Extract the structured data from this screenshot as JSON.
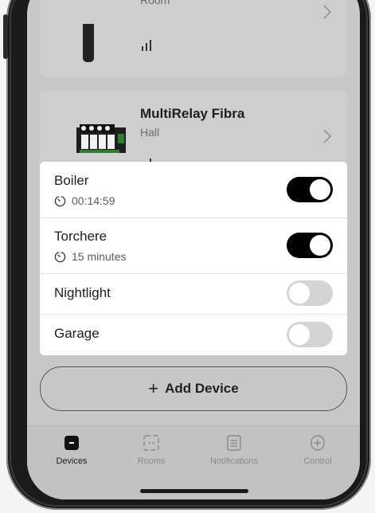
{
  "devices": [
    {
      "name": "",
      "room": "Room"
    },
    {
      "name": "MultiRelay Fibra",
      "room": "Hall"
    }
  ],
  "relays": [
    {
      "name": "Boiler",
      "detail": "00:14:59",
      "state": "on"
    },
    {
      "name": "Torchere",
      "detail": "15 minutes",
      "state": "on"
    },
    {
      "name": "Nightlight",
      "detail": "",
      "state": "off"
    },
    {
      "name": "Garage",
      "detail": "",
      "state": "off"
    }
  ],
  "add_device": {
    "plus": "+",
    "label": "Add Device"
  },
  "tabs": [
    {
      "label": "Devices",
      "icon": "devices-icon",
      "active": true
    },
    {
      "label": "Rooms",
      "icon": "rooms-icon",
      "active": false
    },
    {
      "label": "Notifications",
      "icon": "notifications-icon",
      "active": false
    },
    {
      "label": "Control",
      "icon": "control-icon",
      "active": false
    }
  ],
  "colors": {
    "toggle_on": "#000000",
    "toggle_off": "#d4d4d4",
    "panel_bg": "#ffffff",
    "dim_bg": "#c8c8c8"
  }
}
